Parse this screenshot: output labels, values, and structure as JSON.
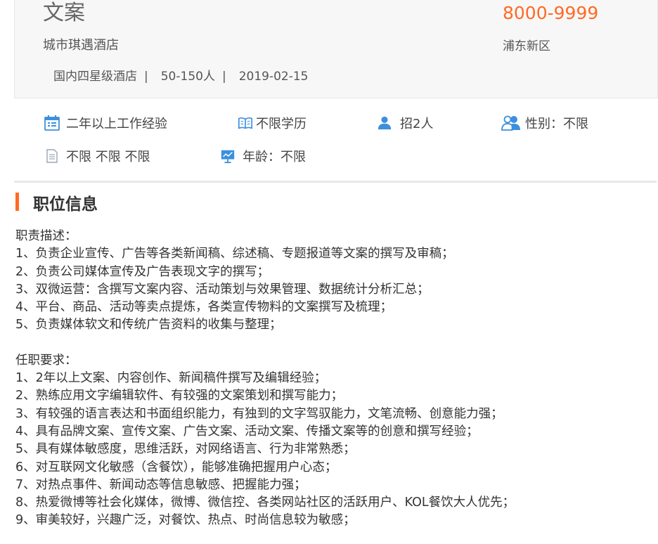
{
  "header": {
    "title": "文案",
    "company": "城市琪遇酒店",
    "company_type": "国内四星级酒店",
    "company_size": "50-150人",
    "post_date": "2019-02-15",
    "separator": "|",
    "salary": "8000-9999",
    "district": "浦东新区"
  },
  "requirements": {
    "experience": "二年以上工作经验",
    "education": "不限学历",
    "headcount": "招2人",
    "gender": "性别：不限",
    "other": "不限 不限 不限",
    "age": "年龄：不限"
  },
  "icons": {
    "experience": "calendar-icon",
    "education": "book-icon",
    "headcount": "person-icon",
    "gender": "people-icon",
    "other": "document-icon",
    "age": "presentation-icon"
  },
  "section": {
    "title": "职位信息"
  },
  "description": {
    "duties_heading": "职责描述：",
    "duties": [
      "1、负责企业宣传、广告等各类新闻稿、综述稿、专题报道等文案的撰写及审稿；",
      "2、负责公司媒体宣传及广告表现文字的撰写；",
      "3、双微运营：含撰写文案内容、活动策划与效果管理、数据统计分析汇总；",
      "4、平台、商品、活动等卖点提炼，各类宣传物料的文案撰写及梳理；",
      "5、负责媒体软文和传统广告资料的收集与整理；"
    ],
    "requirements_heading": "任职要求：",
    "requirements": [
      "1、2年以上文案、内容创作、新闻稿件撰写及编辑经验；",
      "2、熟练应用文字编辑软件、有较强的文案策划和撰写能力；",
      "3、有较强的语言表达和书面组织能力，有独到的文字驾驭能力，文笔流畅、创意能力强；",
      "4、具有品牌文案、宣传文案、广告文案、活动文案、传播文案等的创意和撰写经验；",
      "5、具有媒体敏感度，思维活跃，对网络语言、行为非常熟悉；",
      "6、对互联网文化敏感（含餐饮），能够准确把握用户心态；",
      "7、对热点事件、新闻动态等信息敏感、把握能力强；",
      "8、热爱微博等社会化媒体，微博、微信控、各类网站社区的活跃用户、KOL餐饮大人优先；",
      "9、审美较好，兴趣广泛，对餐饮、热点、时尚信息较为敏感；"
    ]
  },
  "colors": {
    "accent": "#ff6a25",
    "icon_blue": "#3c8fde",
    "icon_gray": "#9aa6b4"
  }
}
